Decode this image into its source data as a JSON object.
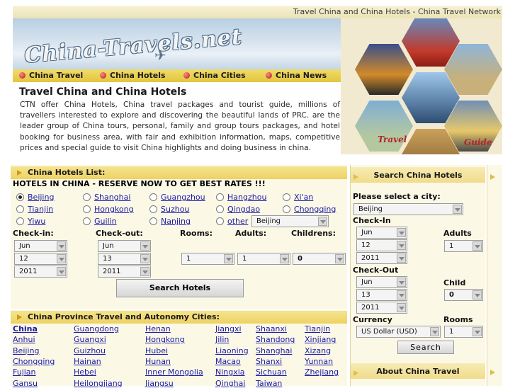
{
  "top_title": "Travel China and China Hotels - China Travel Network",
  "logo_text": "China-Travels.net",
  "nav": [
    "China Travel",
    "China Hotels",
    "China Cities",
    "China News"
  ],
  "collage": {
    "label_travel": "Travel",
    "label_guide": "Guide"
  },
  "intro": {
    "title": "Travel China and China Hotels",
    "text": "CTN offer China Hotels, China travel packages and tourist guide, millions of travellers interested to explore and discovering the beautiful lands of PRC. are the leader group of China tours, personal, family and group tours packages, and hotel booking for business area, with fair and exhibition information, maps, competitive prices and special guide to visit China highlights and doing business in china."
  },
  "hotels": {
    "heading": "China Hotels List:",
    "reserve": "HOTELS IN CHINA - RESERVE NOW TO GET BEST RATES !!!",
    "cities": [
      [
        "Beijing",
        "Shanghai",
        "Guangzhou",
        "Hangzhou",
        "Xi'an"
      ],
      [
        "Tianjin",
        "Hongkong",
        "Suzhou",
        "Qingdao",
        "Chongqing"
      ],
      [
        "Yiwu",
        "Guilin",
        "Nanjing",
        "other"
      ]
    ],
    "other_select": "Beijing",
    "labels": {
      "checkin": "Check-in:",
      "checkout": "Check-out:",
      "rooms": "Rooms:",
      "adults": "Adults:",
      "childrens": "Childrens:"
    },
    "checkin": {
      "month": "Jun",
      "day": "12",
      "year": "2011"
    },
    "checkout": {
      "month": "Jun",
      "day": "13",
      "year": "2011"
    },
    "rooms": "1",
    "adults": "1",
    "children": "0",
    "search_button": "Search Hotels"
  },
  "province": {
    "heading": "China Province Travel and Autonomy Cities:",
    "rows": [
      [
        "China",
        "Guangdong",
        "Henan",
        "Jiangxi",
        "Shaanxi",
        "Tianjin"
      ],
      [
        "Anhui",
        "Guangxi",
        "Hongkong",
        "Jilin",
        "Shandong",
        "Xinjiang"
      ],
      [
        "Beijing",
        "Guizhou",
        "Hubei",
        "Liaoning",
        "Shanghai",
        "Xizang"
      ],
      [
        "Chongqing",
        "Hainan",
        "Hunan",
        "Macao",
        "Shanxi",
        "Yunnan"
      ],
      [
        "Fujian",
        "Hebei",
        "Inner Mongolia",
        "Ningxia",
        "Sichuan",
        "Zhejiang"
      ],
      [
        "Gansu",
        "Heilongjiang",
        "Jiangsu",
        "Qinghai",
        "Taiwan",
        ""
      ]
    ]
  },
  "sidebar": {
    "heading": "Search China Hotels",
    "city_label": "Please select a city:",
    "city_value": "Beijing",
    "checkin_label": "Check-In",
    "checkin": {
      "month": "Jun",
      "day": "12",
      "year": "2011"
    },
    "adults_label": "Adults",
    "adults_value": "1",
    "checkout_label": "Check-Out",
    "checkout": {
      "month": "Jun",
      "day": "13",
      "year": "2011"
    },
    "child_label": "Child",
    "child_value": "0",
    "currency_label": "Currency",
    "currency_value": "US Dollar (USD)",
    "rooms_label": "Rooms",
    "rooms_value": "1",
    "search_button": "Search",
    "about_heading": "About China Travel"
  },
  "colors": {
    "accent_yellow": "#eed263",
    "link_blue": "#1a1aa8",
    "panel_bg": "#fbf8e6"
  }
}
